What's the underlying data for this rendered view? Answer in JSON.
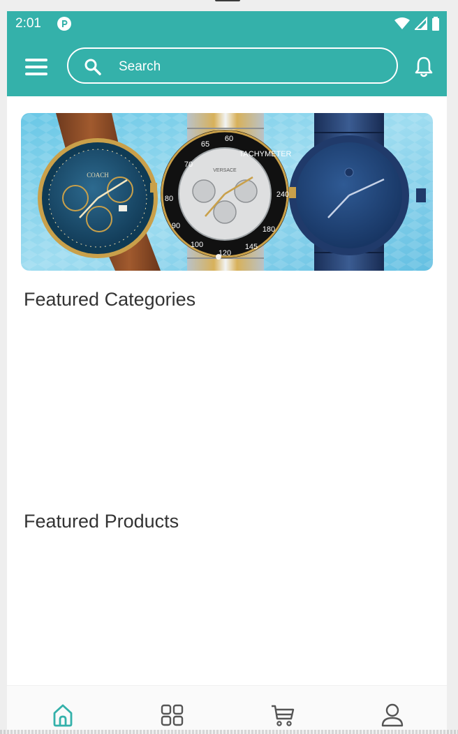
{
  "status_bar": {
    "time": "2:01",
    "icons": [
      "app-notification-icon",
      "wifi-icon",
      "cell-signal-icon",
      "battery-icon"
    ]
  },
  "toolbar": {
    "background_color": "#34b1aa",
    "menu_icon": "hamburger-menu-icon",
    "search": {
      "placeholder": "Search",
      "value": "",
      "icon": "search-icon"
    },
    "notification_icon": "bell-icon"
  },
  "banner": {
    "image": "watches-banner",
    "carousel_indicator": "dot"
  },
  "sections": {
    "categories_title": "Featured Categories",
    "products_title": "Featured Products"
  },
  "bottom_nav": {
    "active_color": "#34b1aa",
    "inactive_color": "#555555",
    "items": [
      {
        "icon": "home-icon",
        "active": true
      },
      {
        "icon": "categories-grid-icon",
        "active": false
      },
      {
        "icon": "cart-icon",
        "active": false
      },
      {
        "icon": "profile-icon",
        "active": false
      }
    ]
  }
}
